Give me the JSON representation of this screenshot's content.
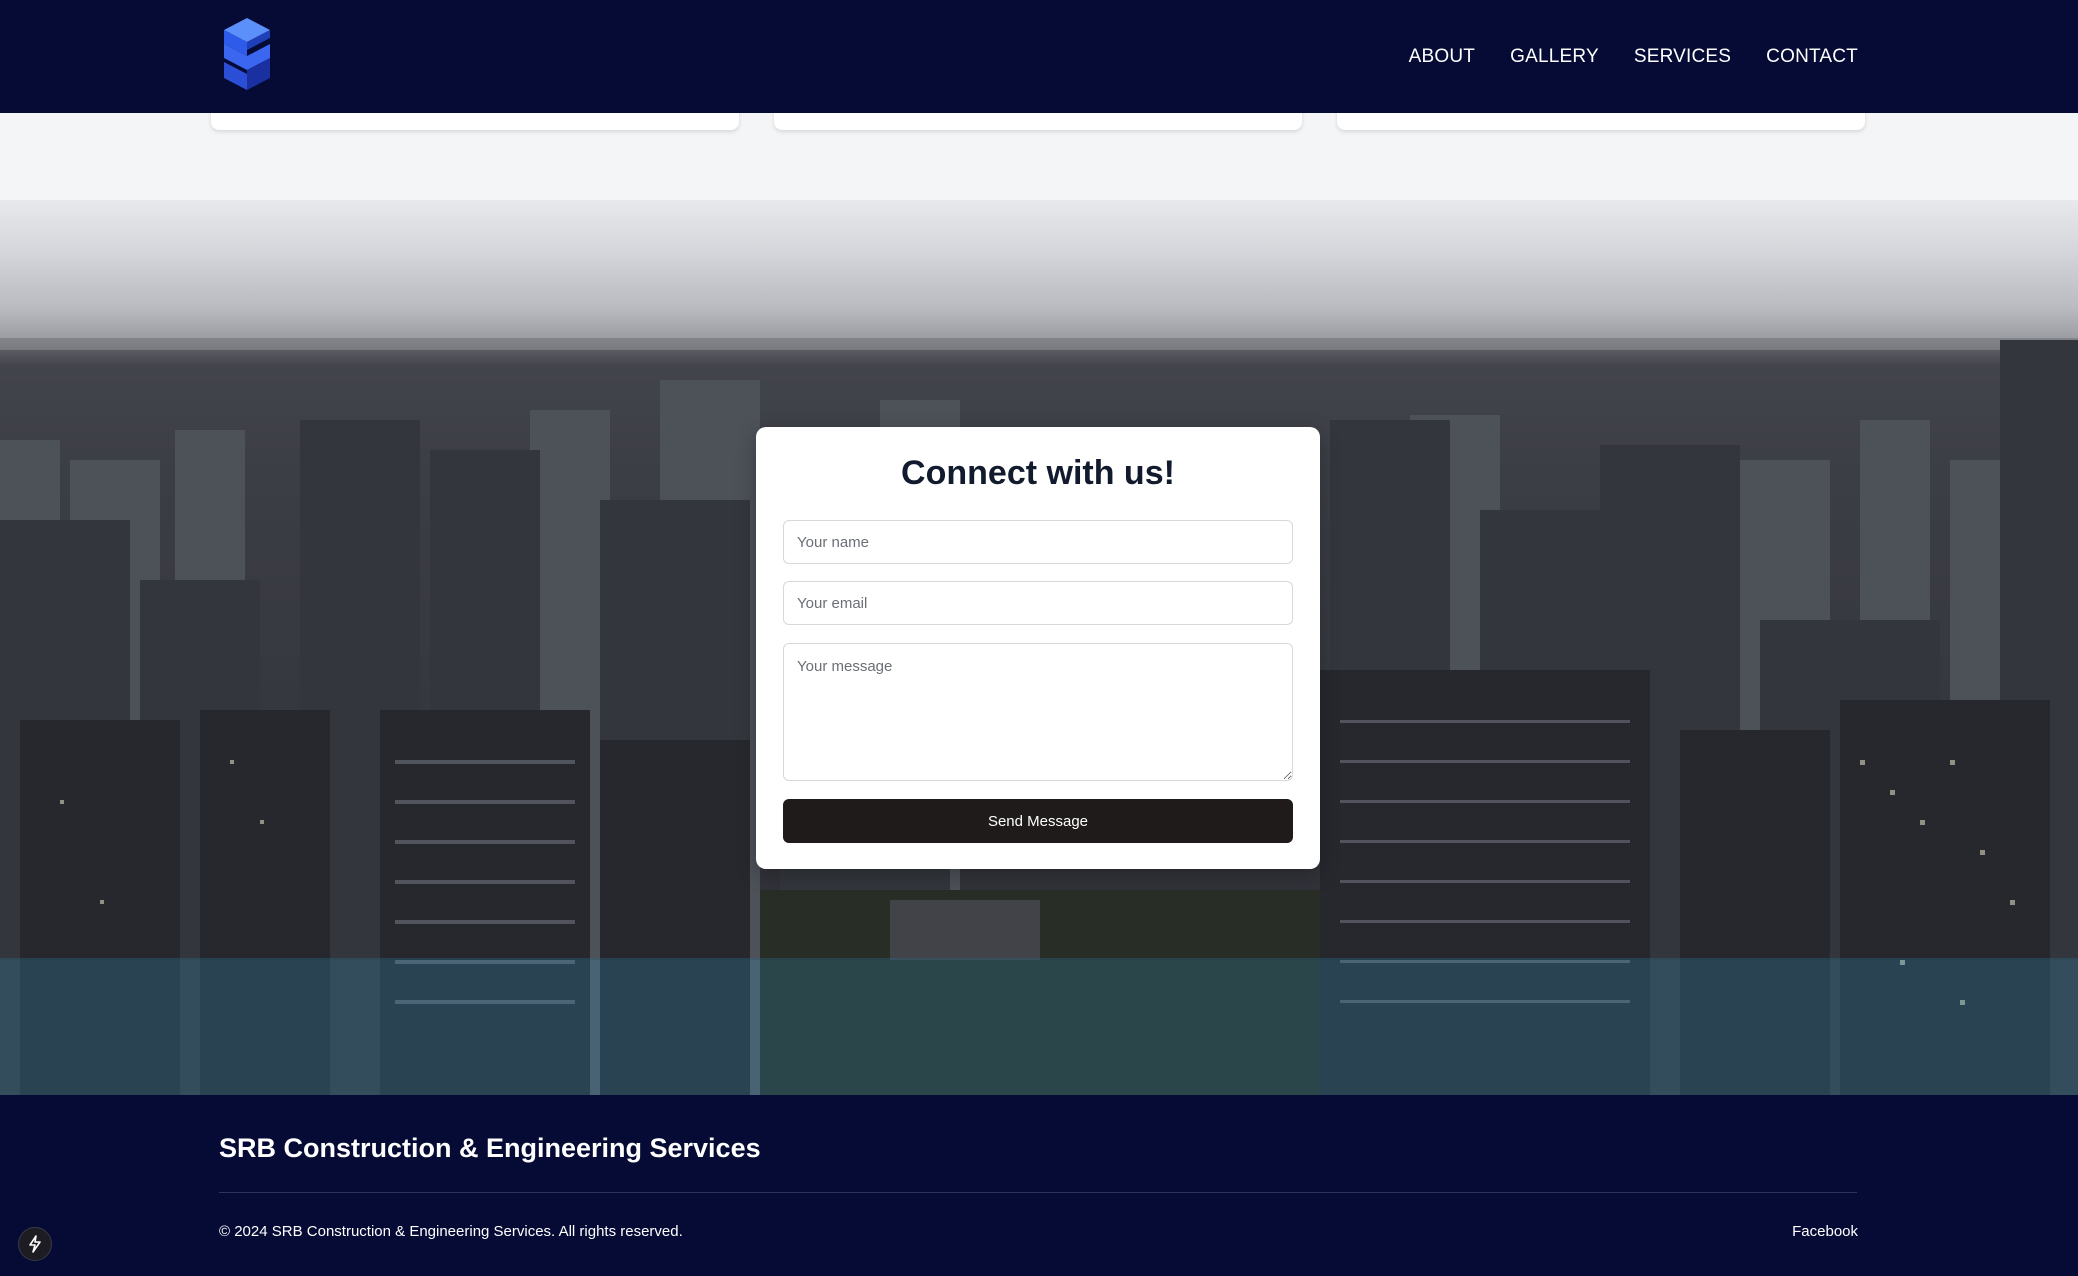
{
  "brand": {
    "logo_icon": "stacked-cube-s-logo",
    "accent": "#2f5bea"
  },
  "nav": {
    "items": [
      {
        "label": "ABOUT"
      },
      {
        "label": "GALLERY"
      },
      {
        "label": "SERVICES"
      },
      {
        "label": "CONTACT"
      }
    ]
  },
  "contact_form": {
    "title": "Connect with us!",
    "name_placeholder": "Your name",
    "email_placeholder": "Your email",
    "message_placeholder": "Your message",
    "submit_label": "Send Message"
  },
  "footer": {
    "company": "SRB Construction & Engineering Services",
    "copyright": "© 2024 SRB Construction & Engineering Services. All rights reserved.",
    "social_link": "Facebook"
  },
  "colors": {
    "header_bg": "#050b35",
    "footer_bg": "#050b35",
    "button_bg": "#1e1b1a"
  },
  "badge_icon": "lightning-icon"
}
